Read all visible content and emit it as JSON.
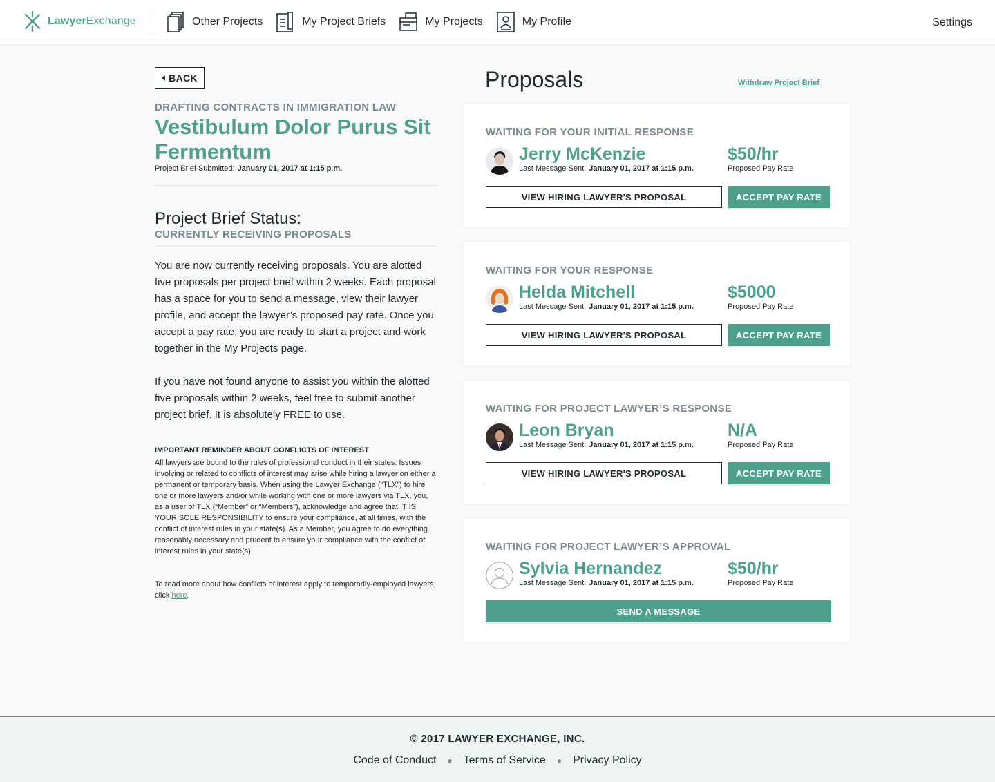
{
  "brand": {
    "name_bold": "Lawyer",
    "name_rest": "Exchange",
    "accent": "#4ea08d"
  },
  "nav": {
    "items": [
      {
        "label": "Other Projects",
        "icon": "documents-stack-icon"
      },
      {
        "label": "My Project Briefs",
        "icon": "brief-document-icon"
      },
      {
        "label": "My Projects",
        "icon": "folder-icon"
      },
      {
        "label": "My Profile",
        "icon": "profile-card-icon"
      }
    ],
    "settings": "Settings"
  },
  "brief": {
    "back_label": "BACK",
    "category": "DRAFTING CONTRACTS IN IMMIGRATION LAW",
    "title": "Vestibulum Dolor Purus Sit Fermentum",
    "submitted_label": "Project Brief Submitted:",
    "submitted_date": "January 01, 2017 at 1:15 p.m.",
    "status_heading": "Project Brief Status:",
    "status_value": "CURRENTLY RECEIVING PROPOSALS",
    "paragraph1": "You are now currently receiving proposals. You are alotted five proposals per project brief within 2 weeks. Each proposal has a space for you to send a message, view their lawyer profile, and accept the lawyer’s proposed pay rate. Once you accept a pay rate, you are ready to start a project and work together in the My Projects page.",
    "paragraph2": "If you have not found anyone to assist you within the alotted five proposals within 2 weeks, feel free to submit another project brief. It is absolutely FREE to use.",
    "reminder_heading": "IMPORTANT REMINDER ABOUT CONFLICTS OF INTEREST",
    "reminder_body": "All lawyers are bound to the rules of professional conduct in their states. Issues involving or related to conflicts of interest may arise while hiring a lawyer on either a permanent or temporary basis. When using the Lawyer Exchange (“TLX”) to hire one or more lawyers and/or while working with one or more lawyers via TLX, you, as a user of TLX (“Member” or “Members”), acknowledge and agree that IT IS YOUR SOLE RESPONSIBILITY to ensure your compliance, at all times, with the conflict of interest rules in your state(s). As a Member, you agree to do everything reasonably necessary and prudent to ensure your compliance with the conflict of interest rules in your state(s).",
    "reminder_more": "To read more about how conflicts of interest apply to temporarily-employed lawyers, click",
    "reminder_link": "here",
    "reminder_end": "."
  },
  "proposals": {
    "title": "Proposals",
    "withdraw_label": "Withdraw Project Brief",
    "last_message_label": "Last Message Sent:",
    "pay_label": "Proposed Pay Rate",
    "view_label": "VIEW HIRING LAWYER'S PROPOSAL",
    "accept_label": "ACCEPT PAY RATE",
    "message_label": "SEND A MESSAGE",
    "cards": [
      {
        "status": "WAITING FOR YOUR INITIAL RESPONSE",
        "name": "Jerry McKenzie",
        "date": "January 01, 2017 at 1:15 p.m.",
        "pay": "$50/hr",
        "avatar": "avatar-man-portrait"
      },
      {
        "status": "WAITING FOR YOUR RESPONSE",
        "name": "Helda Mitchell",
        "date": "January 01, 2017 at 1:15 p.m.",
        "pay": "$5000",
        "avatar": "avatar-woman-portrait"
      },
      {
        "status": "WAITING FOR PROJECT LAWYER’S RESPONSE",
        "name": "Leon Bryan",
        "date": "January 01, 2017 at 1:15 p.m.",
        "pay": "N/A",
        "avatar": "avatar-man-suit"
      },
      {
        "status": "WAITING FOR PROJECT LAWYER’S APPROVAL",
        "name": "Sylvia Hernandez",
        "date": "January 01, 2017 at 1:15 p.m.",
        "pay": "$50/hr",
        "avatar": "avatar-placeholder"
      }
    ]
  },
  "footer": {
    "copyright": "© 2017 LAWYER EXCHANGE, INC.",
    "links": [
      "Code of Conduct",
      "Terms of Service",
      "Privacy Policy"
    ]
  }
}
